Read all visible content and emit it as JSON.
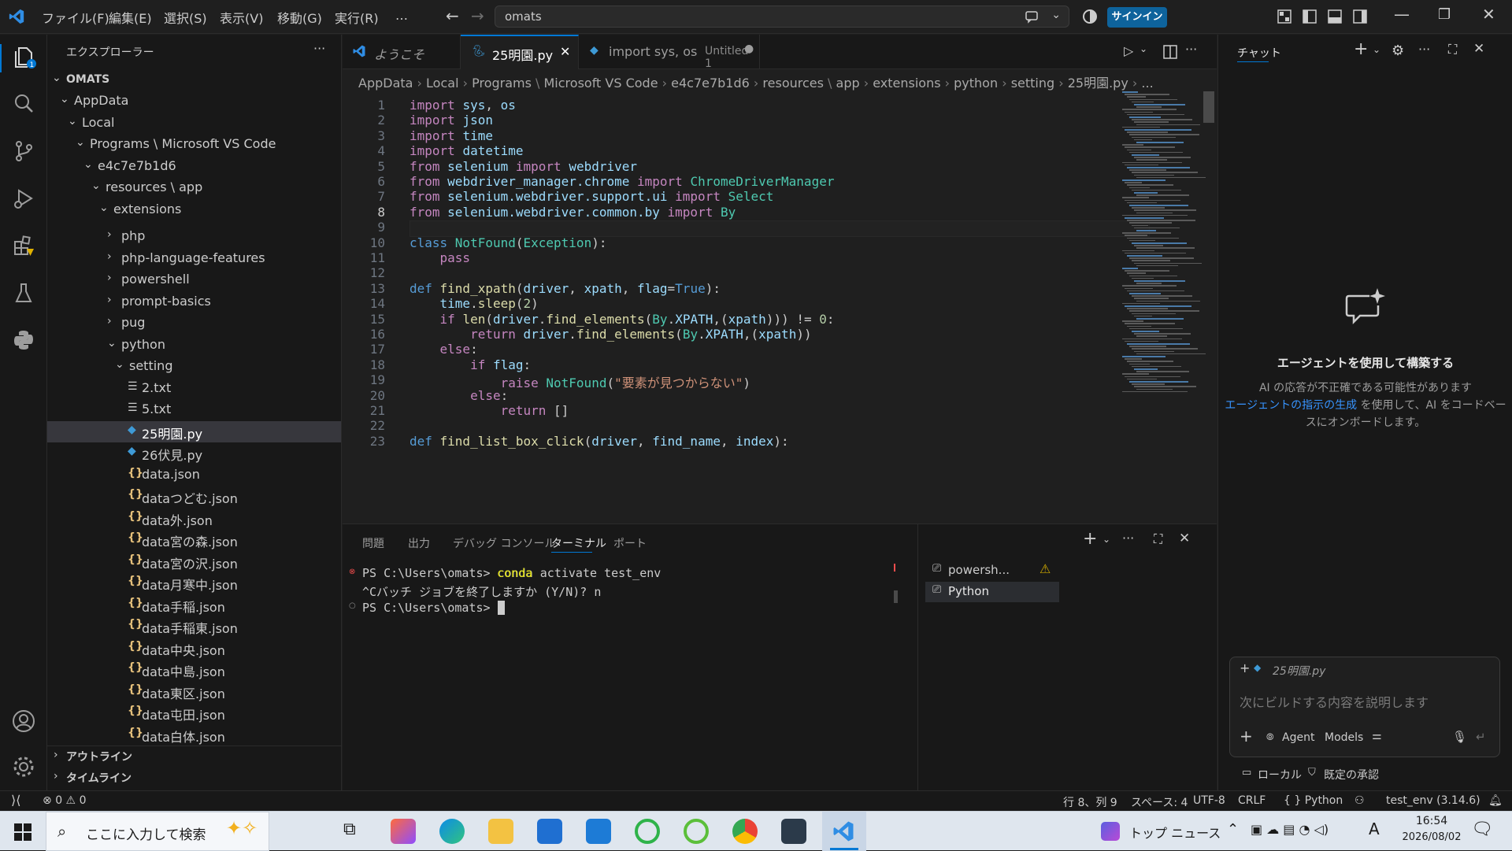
{
  "titlebar": {
    "menu": [
      "ファイル(F)",
      "編集(E)",
      "選択(S)",
      "表示(V)",
      "移動(G)",
      "実行(R)",
      "…"
    ],
    "search_value": "omats",
    "signin_label": "サインイン"
  },
  "sidebar": {
    "title": "エクスプローラー",
    "root": "OMATS",
    "items": [
      {
        "label": "AppData",
        "indent": 1,
        "type": "folder-open"
      },
      {
        "label": "Local",
        "indent": 2,
        "type": "folder-open"
      },
      {
        "label": "Programs \\ Microsoft VS Code",
        "indent": 3,
        "type": "folder-open"
      },
      {
        "label": "e4c7e7b1d6",
        "indent": 4,
        "type": "folder-open"
      },
      {
        "label": "resources \\ app",
        "indent": 5,
        "type": "folder-open"
      },
      {
        "label": "extensions",
        "indent": 6,
        "type": "folder-open"
      },
      {
        "label": "php",
        "indent": 7,
        "type": "folder"
      },
      {
        "label": "php-language-features",
        "indent": 7,
        "type": "folder"
      },
      {
        "label": "powershell",
        "indent": 7,
        "type": "folder"
      },
      {
        "label": "prompt-basics",
        "indent": 7,
        "type": "folder"
      },
      {
        "label": "pug",
        "indent": 7,
        "type": "folder"
      },
      {
        "label": "python",
        "indent": 7,
        "type": "folder-open"
      },
      {
        "label": "setting",
        "indent": 8,
        "type": "folder-open"
      },
      {
        "label": "2.txt",
        "indent": 9,
        "type": "txt"
      },
      {
        "label": "5.txt",
        "indent": 9,
        "type": "txt"
      },
      {
        "label": "25明園.py",
        "indent": 9,
        "type": "py",
        "selected": true
      },
      {
        "label": "26伏見.py",
        "indent": 9,
        "type": "py"
      },
      {
        "label": "data.json",
        "indent": 9,
        "type": "json"
      },
      {
        "label": "dataつどむ.json",
        "indent": 9,
        "type": "json"
      },
      {
        "label": "data外.json",
        "indent": 9,
        "type": "json"
      },
      {
        "label": "data宮の森.json",
        "indent": 9,
        "type": "json"
      },
      {
        "label": "data宮の沢.json",
        "indent": 9,
        "type": "json"
      },
      {
        "label": "data月寒中.json",
        "indent": 9,
        "type": "json"
      },
      {
        "label": "data手稲.json",
        "indent": 9,
        "type": "json"
      },
      {
        "label": "data手稲東.json",
        "indent": 9,
        "type": "json"
      },
      {
        "label": "data中央.json",
        "indent": 9,
        "type": "json"
      },
      {
        "label": "data中島.json",
        "indent": 9,
        "type": "json"
      },
      {
        "label": "data東区.json",
        "indent": 9,
        "type": "json"
      },
      {
        "label": "data屯田.json",
        "indent": 9,
        "type": "json"
      },
      {
        "label": "data白体.json",
        "indent": 9,
        "type": "json"
      }
    ],
    "outline": "アウトライン",
    "timeline": "タイムライン"
  },
  "tabs": [
    {
      "label": "ようこそ",
      "active": false
    },
    {
      "label": "25明園.py",
      "active": true
    },
    {
      "label": "import sys, os",
      "extra": "Untitled-1",
      "active": false
    }
  ],
  "breadcrumb": [
    "AppData",
    "Local",
    "Programs",
    "Microsoft VS Code",
    "e4c7e7b1d6",
    "resources",
    "app",
    "extensions",
    "python",
    "setting",
    "25明園.py",
    "..."
  ],
  "code": [
    [
      [
        "import ",
        "cf"
      ],
      [
        "sys",
        "vr"
      ],
      [
        ", "
      ],
      [
        "os",
        "vr"
      ]
    ],
    [
      [
        "import ",
        "cf"
      ],
      [
        "json",
        "vr"
      ]
    ],
    [
      [
        "import ",
        "cf"
      ],
      [
        "time",
        "vr"
      ]
    ],
    [
      [
        "import ",
        "cf"
      ],
      [
        "datetime",
        "vr"
      ]
    ],
    [
      [
        "from ",
        "cf"
      ],
      [
        "selenium ",
        "vr"
      ],
      [
        "import ",
        "cf"
      ],
      [
        "webdriver",
        "vr"
      ]
    ],
    [
      [
        "from ",
        "cf"
      ],
      [
        "webdriver_manager.chrome ",
        "vr"
      ],
      [
        "import ",
        "cf"
      ],
      [
        "ChromeDriverManager",
        "ty"
      ]
    ],
    [
      [
        "from ",
        "cf"
      ],
      [
        "selenium.webdriver.support.ui ",
        "vr"
      ],
      [
        "import ",
        "cf"
      ],
      [
        "Select",
        "ty"
      ]
    ],
    [
      [
        "from ",
        "cf"
      ],
      [
        "selenium.webdriver.common.by ",
        "vr"
      ],
      [
        "import ",
        "cf"
      ],
      [
        "By",
        "ty"
      ]
    ],
    [],
    [
      [
        "class ",
        "kw"
      ],
      [
        "NotFound",
        "ty"
      ],
      [
        "("
      ],
      [
        "Exception",
        "ty"
      ],
      [
        "):"
      ]
    ],
    [
      [
        "    pass",
        "cf"
      ]
    ],
    [],
    [
      [
        "def ",
        "kw"
      ],
      [
        "find_xpath",
        "fn"
      ],
      [
        "("
      ],
      [
        "driver",
        "vr"
      ],
      [
        ", "
      ],
      [
        "xpath",
        "vr"
      ],
      [
        ", "
      ],
      [
        "flag",
        "vr"
      ],
      [
        "="
      ],
      [
        "True",
        "kw"
      ],
      [
        "):"
      ]
    ],
    [
      [
        "    "
      ],
      [
        "time",
        "vr"
      ],
      [
        "."
      ],
      [
        "sleep",
        "fn"
      ],
      [
        "("
      ],
      [
        "2",
        "nm"
      ],
      [
        ")"
      ]
    ],
    [
      [
        "    "
      ],
      [
        "if ",
        "cf"
      ],
      [
        "len",
        "fn"
      ],
      [
        "("
      ],
      [
        "driver",
        "vr"
      ],
      [
        "."
      ],
      [
        "find_elements",
        "fn"
      ],
      [
        "("
      ],
      [
        "By",
        "ty"
      ],
      [
        "."
      ],
      [
        "XPATH",
        "vr"
      ],
      [
        ",("
      ],
      [
        "xpath",
        "vr"
      ],
      [
        "))) != "
      ],
      [
        "0",
        "nm"
      ],
      [
        ":"
      ]
    ],
    [
      [
        "        "
      ],
      [
        "return ",
        "cf"
      ],
      [
        "driver",
        "vr"
      ],
      [
        "."
      ],
      [
        "find_elements",
        "fn"
      ],
      [
        "("
      ],
      [
        "By",
        "ty"
      ],
      [
        "."
      ],
      [
        "XPATH",
        "vr"
      ],
      [
        ",("
      ],
      [
        "xpath",
        "vr"
      ],
      [
        "))"
      ]
    ],
    [
      [
        "    "
      ],
      [
        "else",
        "cf"
      ],
      [
        ":"
      ]
    ],
    [
      [
        "        "
      ],
      [
        "if ",
        "cf"
      ],
      [
        "flag",
        "vr"
      ],
      [
        ":"
      ]
    ],
    [
      [
        "            "
      ],
      [
        "raise ",
        "cf"
      ],
      [
        "NotFound",
        "ty"
      ],
      [
        "("
      ],
      [
        "\"要素が見つからない\"",
        "st"
      ],
      [
        ")"
      ]
    ],
    [
      [
        "        "
      ],
      [
        "else",
        "cf"
      ],
      [
        ":"
      ]
    ],
    [
      [
        "            "
      ],
      [
        "return ",
        "cf"
      ],
      [
        "[]"
      ]
    ],
    [],
    [
      [
        "def ",
        "kw"
      ],
      [
        "find_list_box_click",
        "fn"
      ],
      [
        "("
      ],
      [
        "driver",
        "vr"
      ],
      [
        ", "
      ],
      [
        "find_name",
        "vr"
      ],
      [
        ", "
      ],
      [
        "index",
        "vr"
      ],
      [
        "):"
      ]
    ]
  ],
  "panel": {
    "tabs": [
      "問題",
      "出力",
      "デバッグ コンソール",
      "ターミナル",
      "ポート"
    ],
    "active_tab": "ターミナル",
    "terminal_lines": [
      "PS C:\\Users\\omats> conda activate test_env",
      "^Cバッチ ジョブを終了しますか (Y/N)? n",
      "PS C:\\Users\\omats> "
    ],
    "terminals": [
      "powersh...",
      "Python"
    ]
  },
  "chat": {
    "title": "チャット",
    "heading": "エージェントを使用して構築する",
    "desc1": "AI の応答が不正確である可能性があります",
    "desc_link": "エージェントの指示の生成",
    "desc2": " を使用して、AI をコードベー",
    "desc3": "スにオンボードします。",
    "context_file": "25明園.py",
    "input_placeholder": "次にビルドする内容を説明します",
    "agent_label": "Agent",
    "models_label": "Models",
    "local_label": "ローカル",
    "approve_label": "既定の承認"
  },
  "status": {
    "errors": "0",
    "warnings": "0",
    "position": "行 8、列 9",
    "spaces": "スペース: 4",
    "encoding": "UTF-8",
    "eol": "CRLF",
    "language": "Python",
    "env": "test_env (3.14.6)"
  },
  "taskbar": {
    "search_placeholder": "ここに入力して検索",
    "news": "トップ ニュース",
    "time": "16:54",
    "date": "2026/08/02",
    "ime": "A"
  },
  "colors": {
    "accent": "#0078d4",
    "bg": "#1f1f1f",
    "sidebar": "#181818"
  }
}
